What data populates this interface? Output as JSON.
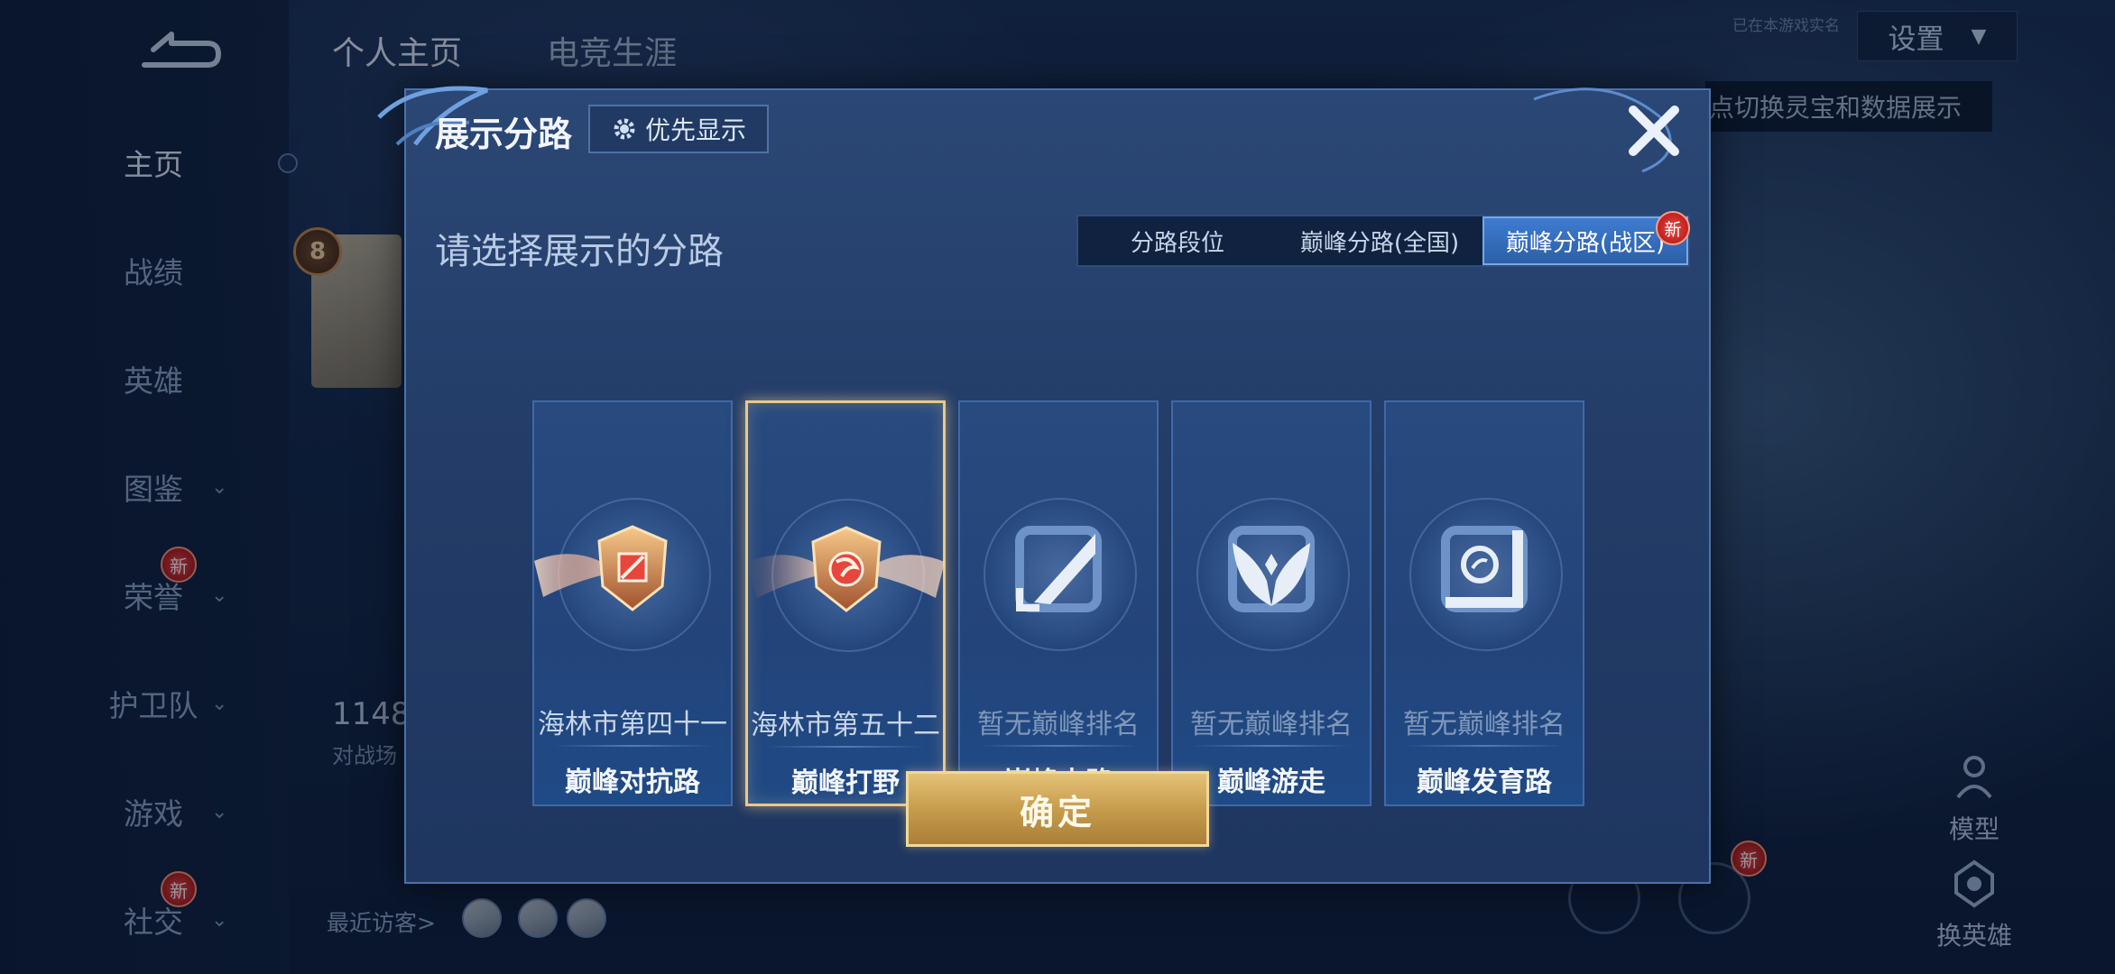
{
  "sidebar": {
    "items": [
      {
        "label": "主页",
        "active": true,
        "chevron": false,
        "badge": ""
      },
      {
        "label": "战绩",
        "active": false,
        "chevron": false,
        "badge": ""
      },
      {
        "label": "英雄",
        "active": false,
        "chevron": false,
        "badge": ""
      },
      {
        "label": "图鉴",
        "active": false,
        "chevron": true,
        "badge": ""
      },
      {
        "label": "荣誉",
        "active": false,
        "chevron": true,
        "badge": "新"
      },
      {
        "label": "护卫队",
        "active": false,
        "chevron": true,
        "badge": ""
      },
      {
        "label": "游戏",
        "active": false,
        "chevron": true,
        "badge": ""
      },
      {
        "label": "社交",
        "active": false,
        "chevron": true,
        "badge": "新"
      }
    ]
  },
  "top_tabs": [
    "个人主页",
    "电竞生涯"
  ],
  "profile": {
    "level": "8",
    "stat_number": "1148",
    "stat_label": "对战场",
    "visitors_label": "最近访客>"
  },
  "right_panel": {
    "realname_text": "已在本游戏实名",
    "settings_label": "设置",
    "tip_text": "点切换灵宝和数据展示",
    "model_label": "模型",
    "change_hero_label": "换英雄",
    "new_badge": "新"
  },
  "dialog": {
    "title": "展示分路",
    "priority_label": "优先显示",
    "subtitle": "请选择展示的分路",
    "tabs": [
      {
        "label": "分路段位",
        "active": false
      },
      {
        "label": "巅峰分路(全国)",
        "active": false
      },
      {
        "label": "巅峰分路(战区)",
        "active": true,
        "badge": "新"
      }
    ],
    "cards": [
      {
        "rank": "海林市第四十一",
        "role": "巅峰对抗路",
        "selected": false,
        "ranked": true
      },
      {
        "rank": "海林市第五十二",
        "role": "巅峰打野",
        "selected": true,
        "ranked": true
      },
      {
        "rank": "暂无巅峰排名",
        "role": "巅峰中路",
        "selected": false,
        "ranked": false
      },
      {
        "rank": "暂无巅峰排名",
        "role": "巅峰游走",
        "selected": false,
        "ranked": false
      },
      {
        "rank": "暂无巅峰排名",
        "role": "巅峰发育路",
        "selected": false,
        "ranked": false
      }
    ],
    "confirm_label": "确定"
  },
  "icons": {
    "back": "back-arrow-icon",
    "gear": "gear-icon",
    "close": "close-icon",
    "chevron": "chevron-down-icon"
  },
  "colors": {
    "accent_gold": "#e9c98a",
    "dialog_bg": "#233d68",
    "active_tab": "#3e7cd0",
    "badge_red": "#d83030"
  }
}
